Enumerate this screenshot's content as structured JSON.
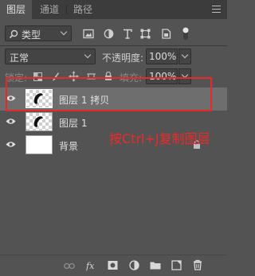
{
  "tabs": [
    {
      "label": "图层",
      "active": true
    },
    {
      "label": "通道",
      "active": false
    },
    {
      "label": "路径",
      "active": false
    }
  ],
  "filter": {
    "kind_label": "类型"
  },
  "blend": {
    "mode": "正常",
    "opacity_label": "不透明度:",
    "opacity_value": "100%"
  },
  "lock": {
    "label": "锁定:",
    "fill_label": "填充:",
    "fill_value": "100%"
  },
  "layers": [
    {
      "name": "图层 1 拷贝",
      "selected": true,
      "thumb": "transparent-with-shape"
    },
    {
      "name": "图层 1",
      "selected": false,
      "thumb": "transparent-with-shape"
    },
    {
      "name": "背景",
      "selected": false,
      "thumb": "white",
      "locked": true
    }
  ],
  "annotation": {
    "text": "按Ctrl+J复制图层",
    "color": "#f02828"
  },
  "colors": {
    "panel": "#535353",
    "tabbar": "#3c3c3c",
    "selection": "#6e6e6e",
    "annotation": "#e8292c"
  }
}
